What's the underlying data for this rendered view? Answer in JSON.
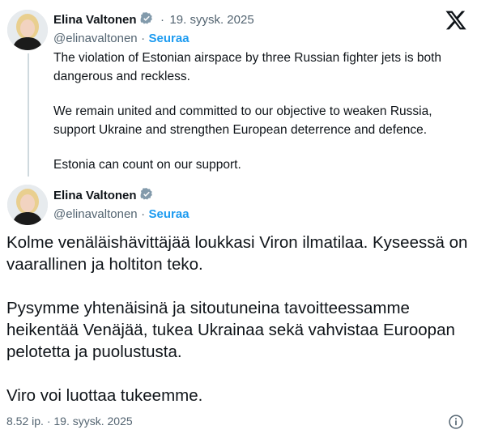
{
  "quoted_post": {
    "author_name": "Elina Valtonen",
    "date": "19. syysk. 2025",
    "handle": "@elinavaltonen",
    "follow_label": "Seuraa",
    "paragraphs": [
      "The violation of Estonian airspace by three Russian fighter jets is both dangerous and reckless.",
      "We remain united and committed to our objective to weaken Russia, support Ukraine and strengthen European deterrence and defence.",
      "Estonia can count on our support."
    ]
  },
  "main_post": {
    "author_name": "Elina Valtonen",
    "handle": "@elinavaltonen",
    "follow_label": "Seuraa",
    "paragraphs": [
      "Kolme venäläishävittäjää loukkasi Viron ilmatilaa. Kyseessä on vaarallinen ja holtiton teko.",
      "Pysymme yhtenäisinä ja sitoutuneina tavoitteessamme heikentää Venäjää, tukea Ukrainaa sekä vahvistaa Euroopan pelotetta ja puolustusta.",
      "Viro voi luottaa tukeemme."
    ],
    "footer": "8.52 ip. · 19. syysk. 2025"
  },
  "separator": "·",
  "colors": {
    "text": "#0f1419",
    "secondary": "#536471",
    "link": "#1d9bf0",
    "verified": "#829aab"
  },
  "icons": [
    "verified-badge-icon",
    "x-logo-icon",
    "info-icon"
  ]
}
